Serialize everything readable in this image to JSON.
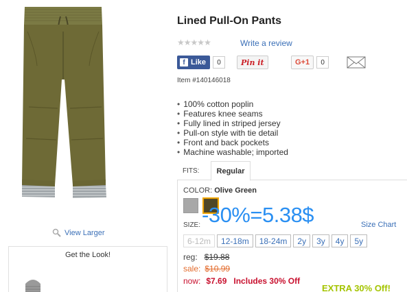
{
  "product": {
    "title": "Lined Pull-On Pants",
    "item_number": "Item #140146018",
    "write_review": "Write a review",
    "view_larger": "View Larger",
    "get_the_look": "Get the Look!",
    "features": [
      "100% cotton poplin",
      "Features knee seams",
      "Fully lined in striped jersey",
      "Pull-on style with tie detail",
      "Front and back pockets",
      "Machine washable; imported"
    ]
  },
  "social": {
    "facebook_label": "Like",
    "facebook_count": "0",
    "pinterest_label": "Pin it",
    "gplus_label": "G+1",
    "gplus_count": "0"
  },
  "fits": {
    "label": "FITS:",
    "selected": "Regular"
  },
  "color": {
    "label": "COLOR:",
    "selected": "Olive Green",
    "swatches": [
      {
        "name": "Grey",
        "hex": "#a8a8a8"
      },
      {
        "name": "Olive Green",
        "hex": "#4f4626"
      }
    ]
  },
  "promo_overlay": "-30%=5.38$",
  "size": {
    "label": "SIZE:",
    "chart_link": "Size Chart",
    "options": [
      "6-12m",
      "12-18m",
      "18-24m",
      "2y",
      "3y",
      "4y",
      "5y"
    ],
    "disabled": [
      "6-12m"
    ]
  },
  "prices": {
    "reg_label": "reg:",
    "reg_value": "$19.88",
    "sale_label": "sale:",
    "sale_value": "$10.99",
    "now_label": "now:",
    "now_value": "$7.69",
    "includes": "Includes 30% Off",
    "extra_banner": "EXTRA 30% Off!"
  },
  "colors": {
    "link": "#3a6fb7",
    "sale": "#e36b2c",
    "now": "#c8102e",
    "promo": "#2a8ff2",
    "extra": "#a4c400"
  }
}
